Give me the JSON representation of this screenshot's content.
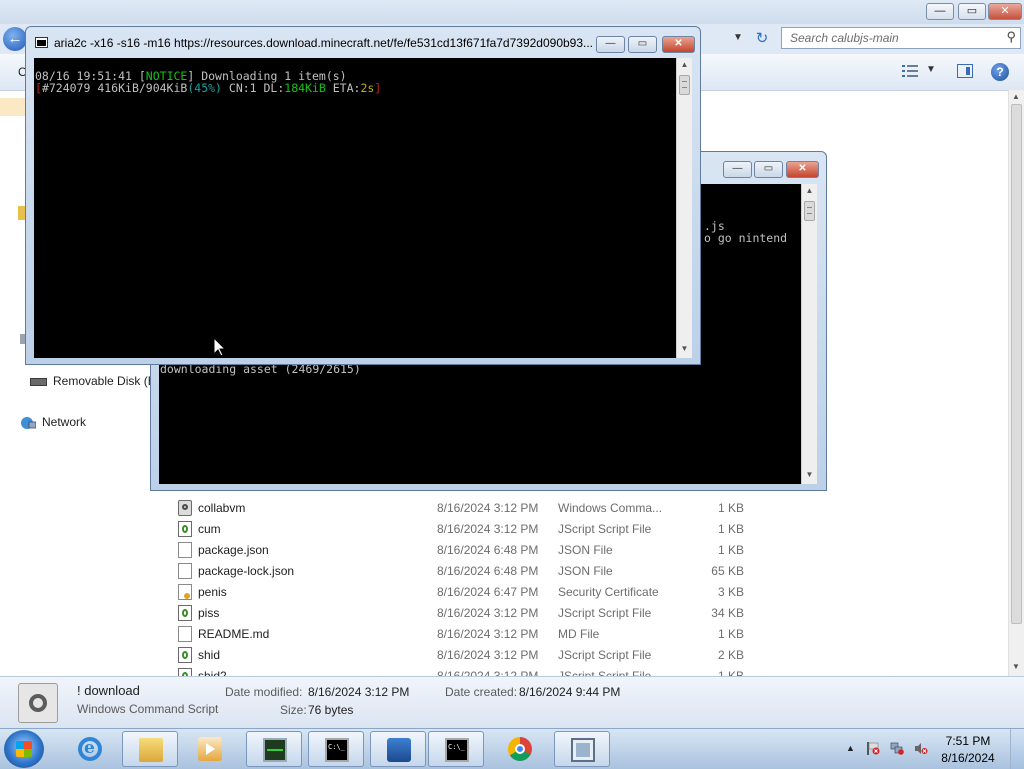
{
  "explorer": {
    "search_placeholder": "Search calubjs-main",
    "toolbar_partial": "O",
    "nav": {
      "removable_disk": "Removable Disk (E",
      "network": "Network"
    },
    "files": [
      {
        "name": "collabvm",
        "date": "8/16/2024 3:12 PM",
        "type": "Windows Comma...",
        "size": "1 KB",
        "icon": "cmd-script-icon"
      },
      {
        "name": "cum",
        "date": "8/16/2024 3:12 PM",
        "type": "JScript Script File",
        "size": "1 KB",
        "icon": "jscript-file-icon"
      },
      {
        "name": "package.json",
        "date": "8/16/2024 6:48 PM",
        "type": "JSON File",
        "size": "1 KB",
        "icon": "document-icon"
      },
      {
        "name": "package-lock.json",
        "date": "8/16/2024 6:48 PM",
        "type": "JSON File",
        "size": "65 KB",
        "icon": "document-icon"
      },
      {
        "name": "penis",
        "date": "8/16/2024 6:47 PM",
        "type": "Security Certificate",
        "size": "3 KB",
        "icon": "certificate-icon"
      },
      {
        "name": "piss",
        "date": "8/16/2024 3:12 PM",
        "type": "JScript Script File",
        "size": "34 KB",
        "icon": "jscript-file-icon"
      },
      {
        "name": "README.md",
        "date": "8/16/2024 3:12 PM",
        "type": "MD File",
        "size": "1 KB",
        "icon": "document-icon"
      },
      {
        "name": "shid",
        "date": "8/16/2024 3:12 PM",
        "type": "JScript Script File",
        "size": "2 KB",
        "icon": "jscript-file-icon"
      },
      {
        "name": "shid2",
        "date": "8/16/2024 3:12 PM",
        "type": "JScript Script File",
        "size": "1 KB",
        "icon": "jscript-file-icon"
      }
    ],
    "details": {
      "name": "! download",
      "type": "Windows Command Script",
      "modified_label": "Date modified:",
      "modified_value": "8/16/2024 3:12 PM",
      "created_label": "Date created:",
      "created_value": "8/16/2024 9:44 PM",
      "size_label": "Size:",
      "size_value": "76 bytes"
    }
  },
  "console_back": {
    "line_js": ".js",
    "line_nintendo": "o go nintend",
    "line_asset": "downloading asset (2469/2615)"
  },
  "console_front": {
    "title": "aria2c  -x16 -s16 -m16 https://resources.download.minecraft.net/fe/fe531cd13f671fa7d7392d090b93...",
    "line1_time": "08/16 19:51:41 ",
    "line1_bracket_open": "[",
    "line1_notice": "NOTICE",
    "line1_bracket_close": "]",
    "line1_msg": " Downloading 1 item(s)",
    "line2_open": "[",
    "line2_progress": "#724079 416KiB/904KiB",
    "line2_pct": "(45%)",
    "line2_cn": " CN:1 DL:",
    "line2_dl": "184KiB",
    "line2_eta_label": " ETA:",
    "line2_eta": "2s",
    "line2_close": "]",
    "progress_fraction": 0.45
  },
  "taskbar": {
    "time": "7:51 PM",
    "date": "8/16/2024",
    "items": [
      "internet-explorer",
      "file-explorer",
      "media-player",
      "task-manager",
      "command-prompt",
      "file-shredder",
      "command-prompt",
      "chrome",
      "application-window"
    ]
  },
  "window_controls": {
    "minimize": "—",
    "maximize": "▭",
    "close": "✕"
  },
  "colors": {
    "console_bg": "#000000",
    "notice_green": "#13c313",
    "pct_cyan": "#1aa0a0",
    "bracket_red": "#c02020",
    "eta_yellow": "#c0b000"
  }
}
